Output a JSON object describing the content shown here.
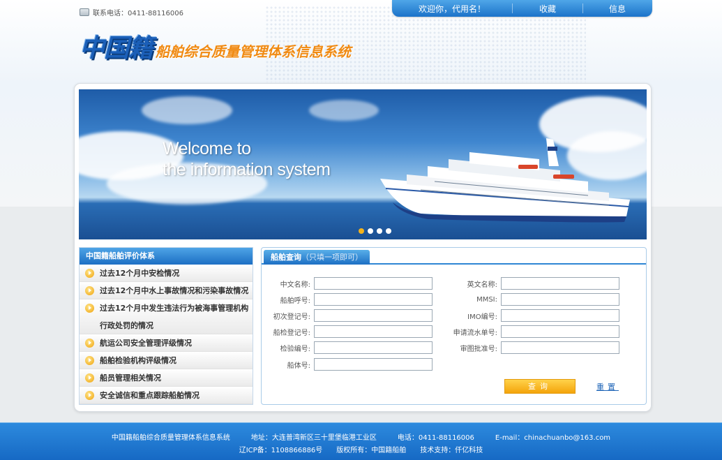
{
  "header": {
    "phone_label": "联系电话：0411-88116006",
    "welcome": "欢迎你，代用名！",
    "nav": [
      "收藏",
      "信息"
    ]
  },
  "logo": {
    "main": "中国籍",
    "sub": "船舶综合质量管理体系信息系统"
  },
  "banner": {
    "line1": "Welcome to",
    "line2": "the information system",
    "slides": 4,
    "active_slide": 1
  },
  "sidebar": {
    "title": "中国籍船舶评价体系",
    "items": [
      {
        "label": "过去12个月中安检情况"
      },
      {
        "label": "过去12个月中水上事故情况和污染事故情况"
      },
      {
        "label": "过去12个月中发生违法行为被海事管理机构",
        "label2": "行政处罚的情况"
      },
      {
        "label": "航运公司安全管理评级情况"
      },
      {
        "label": "船舶检验机构评级情况"
      },
      {
        "label": "船员管理相关情况"
      },
      {
        "label": "安全诚信和重点跟踪船舶情况"
      }
    ]
  },
  "query": {
    "tab_title": "船舶查询",
    "tab_note": "（只填一项即可）",
    "left_fields": [
      {
        "label": "中文名称:",
        "value": ""
      },
      {
        "label": "船舶呼号:",
        "value": ""
      },
      {
        "label": "初次登记号:",
        "value": ""
      },
      {
        "label": "船检登记号:",
        "value": ""
      },
      {
        "label": "检验编号:",
        "value": ""
      },
      {
        "label": "船体号:",
        "value": ""
      }
    ],
    "right_fields": [
      {
        "label": "英文名称:",
        "value": ""
      },
      {
        "label": "MMSI:",
        "value": ""
      },
      {
        "label": "IMO编号:",
        "value": ""
      },
      {
        "label": "申请流水单号:",
        "value": ""
      },
      {
        "label": "审图批准号:",
        "value": ""
      }
    ],
    "query_button": "查询",
    "reset_button": "重置"
  },
  "footer": {
    "system_name": "中国籍船舶综合质量管理体系信息系统",
    "address": "地址：大连普湾新区三十里堡临港工业区",
    "phone": "电话：0411-88116006",
    "email": "E-mail：chinachuanbo@163.com",
    "icp": "辽ICP备：1108866886号",
    "copyright": "版权所有：中国籍船舶",
    "support": "技术支持：仟亿科技"
  },
  "colors": {
    "brand_blue": "#1d6fc4",
    "accent_orange": "#f4a40b"
  }
}
